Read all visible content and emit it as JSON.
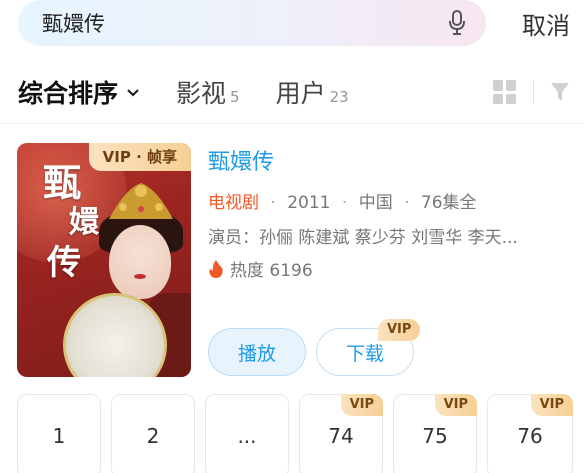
{
  "search": {
    "query": "甄嬛传",
    "cancel_label": "取消"
  },
  "tabs": {
    "sort_label": "综合排序",
    "items": [
      {
        "label": "影视",
        "count": "5"
      },
      {
        "label": "用户",
        "count": "23"
      }
    ]
  },
  "result": {
    "poster_badge": "VIP · 帧享",
    "poster_calligraphy": [
      "甄",
      "嬛",
      "传"
    ],
    "title": "甄嬛传",
    "type": "电视剧",
    "year": "2011",
    "region": "中国",
    "episodes": "76集全",
    "cast": "演员：孙俪 陈建斌 蔡少芬 刘雪华 李天...",
    "heat": "热度 6196",
    "play_label": "播放",
    "download_label": "下载",
    "download_badge": "VIP"
  },
  "episodes": [
    {
      "label": "1",
      "vip": ""
    },
    {
      "label": "2",
      "vip": ""
    },
    {
      "label": "...",
      "vip": ""
    },
    {
      "label": "74",
      "vip": "VIP"
    },
    {
      "label": "75",
      "vip": "VIP"
    },
    {
      "label": "76",
      "vip": "VIP"
    }
  ],
  "colors": {
    "accent": "#1f9be6",
    "type": "#f05a28",
    "vip_gold": "#f6cf94"
  },
  "icons": [
    "mic-icon",
    "chevron-down-icon",
    "grid-view-icon",
    "filter-icon",
    "flame-icon"
  ]
}
